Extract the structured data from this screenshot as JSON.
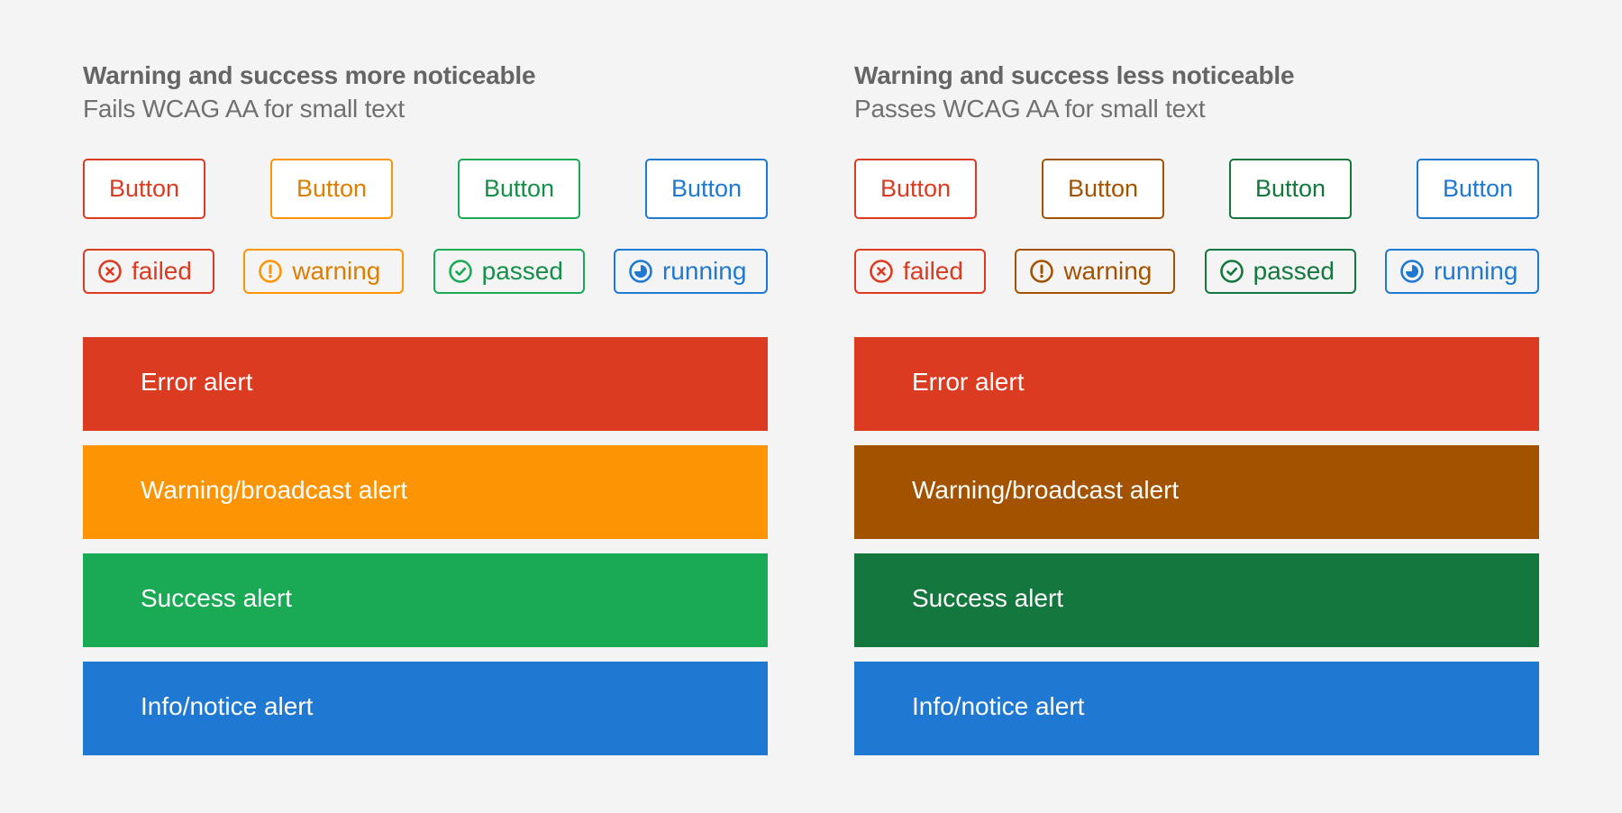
{
  "panels": [
    {
      "id": "more-noticeable",
      "title": "Warning and success more noticeable",
      "subtitle": "Fails WCAG AA for small text",
      "colors": {
        "error": "#da3b21",
        "warning": "#fc9403",
        "success": "#1aaa55",
        "info": "#1f78d1",
        "warning_text": "#de7e00",
        "success_text": "#168f48"
      },
      "buttons": [
        {
          "label": "Button",
          "variant": "error"
        },
        {
          "label": "Button",
          "variant": "warning"
        },
        {
          "label": "Button",
          "variant": "success"
        },
        {
          "label": "Button",
          "variant": "info"
        }
      ],
      "badges": [
        {
          "label": "failed",
          "icon": "error-x-circle-icon",
          "variant": "error"
        },
        {
          "label": "warning",
          "icon": "warning-exclamation-circle-icon",
          "variant": "warning"
        },
        {
          "label": "passed",
          "icon": "check-circle-icon",
          "variant": "success"
        },
        {
          "label": "running",
          "icon": "running-pie-circle-icon",
          "variant": "info"
        }
      ],
      "alerts": [
        {
          "label": "Error alert",
          "variant": "error"
        },
        {
          "label": "Warning/broadcast alert",
          "variant": "warning"
        },
        {
          "label": "Success alert",
          "variant": "success"
        },
        {
          "label": "Info/notice alert",
          "variant": "info"
        }
      ]
    },
    {
      "id": "less-noticeable",
      "title": "Warning and success less noticeable",
      "subtitle": "Passes WCAG AA for small text",
      "colors": {
        "error": "#da3b21",
        "warning": "#a35200",
        "success": "#14773d",
        "info": "#1f78d1",
        "warning_text": "#a35200",
        "success_text": "#14773d"
      },
      "buttons": [
        {
          "label": "Button",
          "variant": "error"
        },
        {
          "label": "Button",
          "variant": "warning"
        },
        {
          "label": "Button",
          "variant": "success"
        },
        {
          "label": "Button",
          "variant": "info"
        }
      ],
      "badges": [
        {
          "label": "failed",
          "icon": "error-x-circle-icon",
          "variant": "error"
        },
        {
          "label": "warning",
          "icon": "warning-exclamation-circle-icon",
          "variant": "warning"
        },
        {
          "label": "passed",
          "icon": "check-circle-icon",
          "variant": "success"
        },
        {
          "label": "running",
          "icon": "running-pie-circle-icon",
          "variant": "info"
        }
      ],
      "alerts": [
        {
          "label": "Error alert",
          "variant": "error"
        },
        {
          "label": "Warning/broadcast alert",
          "variant": "warning"
        },
        {
          "label": "Success alert",
          "variant": "success"
        },
        {
          "label": "Info/notice alert",
          "variant": "info"
        }
      ]
    }
  ]
}
